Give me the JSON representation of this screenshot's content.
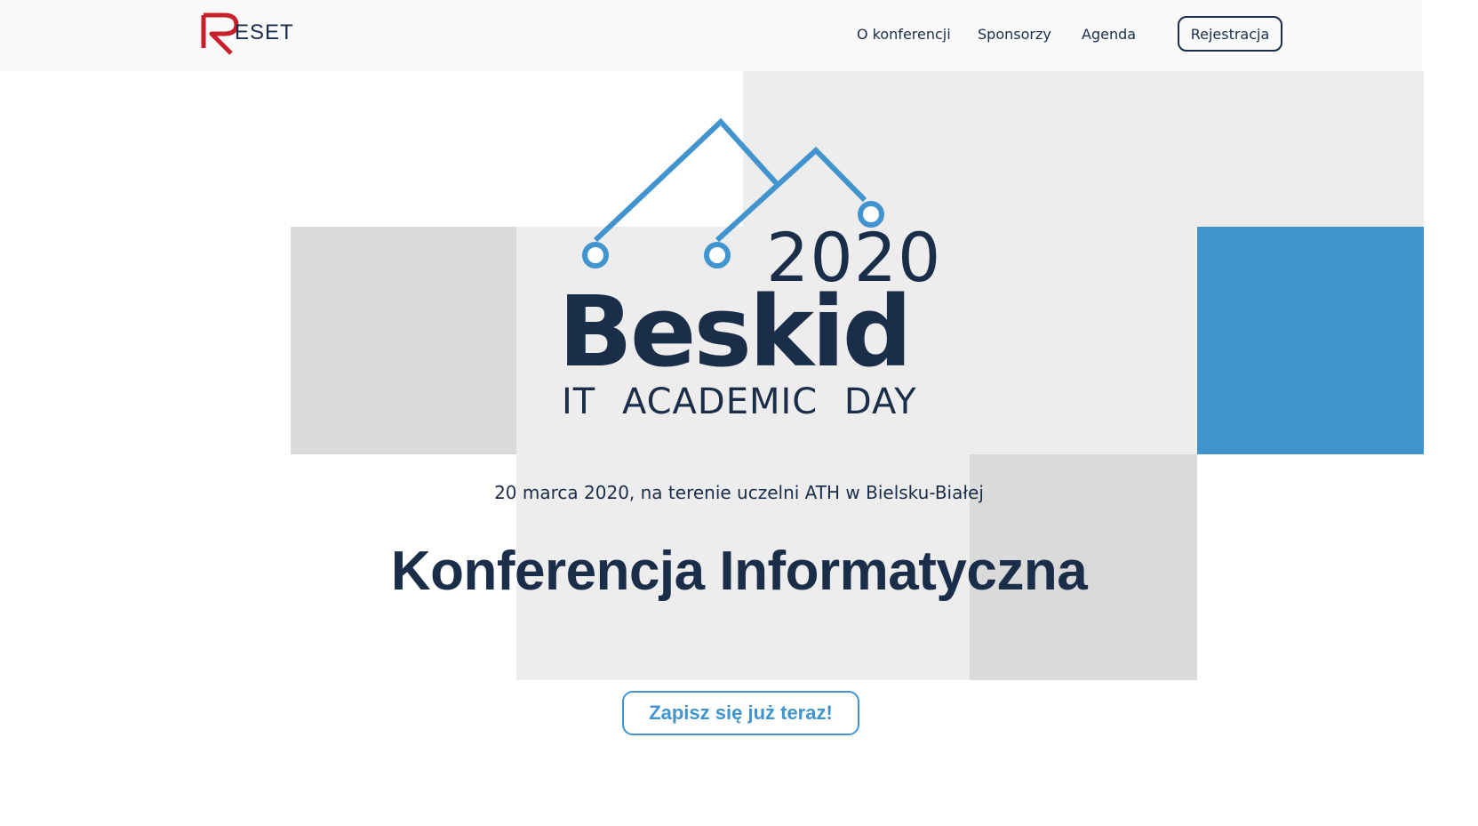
{
  "brand": {
    "logo_text": "RESET",
    "accent_red": "#c8202a",
    "navy": "#1a2e4a",
    "blue": "#4294cf"
  },
  "nav": {
    "items": [
      {
        "label": "O konferencji"
      },
      {
        "label": "Sponsorzy"
      },
      {
        "label": "Agenda"
      }
    ],
    "register_label": "Rejestracja"
  },
  "hero": {
    "year": "2020",
    "name": "Beskid",
    "subtitle": "IT ACADEMIC DAY",
    "event_info": "20 marca 2020, na terenie uczelni ATH w Bielsku-Białej",
    "headline": "Konferencja Informatyczna",
    "cta_label": "Zapisz się już teraz!"
  }
}
